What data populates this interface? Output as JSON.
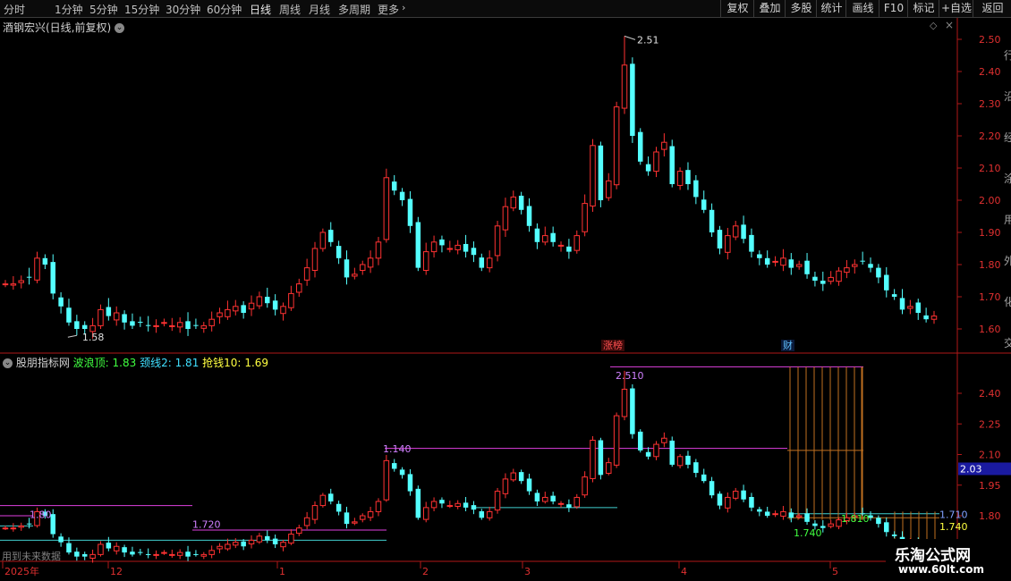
{
  "toolbar": {
    "periods": [
      "分时",
      "1分钟",
      "5分钟",
      "15分钟",
      "30分钟",
      "60分钟",
      "日线",
      "周线",
      "月线",
      "多周期",
      "更多"
    ],
    "active_period": "日线",
    "more_icon": "chevron-right-icon",
    "buttons": [
      "复权",
      "叠加",
      "多股",
      "统计",
      "画线",
      "F10",
      "标记",
      "+自选",
      "返回"
    ]
  },
  "main_panel": {
    "title": "酒钢宏兴(日线,前复权)",
    "title_icon": "chevron-down-icon",
    "diamond_icon": "diamond-icon",
    "close_icon": "close-icon",
    "y_ticks": [
      "2.50",
      "2.40",
      "2.30",
      "2.20",
      "2.10",
      "2.00",
      "1.90",
      "1.80",
      "1.70",
      "1.60"
    ],
    "high_label": "2.51",
    "low_label": "1.58",
    "badge_zhangbang": "涨榜",
    "badge_cai": "财",
    "right_edge_chars": [
      "行",
      "沿",
      "经",
      "涂",
      "用",
      "外",
      "化",
      "交"
    ]
  },
  "indicator_panel": {
    "title": "股朋指标网",
    "wave_label": "波浪顶:",
    "wave_value": "1.83",
    "neck_label": "颈线2:",
    "neck_value": "1.81",
    "grab_label": "抢钱10:",
    "grab_value": "1.69",
    "y_ticks": [
      "2.40",
      "2.25",
      "2.10",
      "1.95",
      "1.80"
    ],
    "current_price": "2.03",
    "annotations": [
      "2.510",
      "1.140",
      "1.720",
      "1.740",
      "1.80",
      "1.810",
      "1.710",
      "1.740"
    ],
    "future_data_note": "用到未来数据"
  },
  "x_axis": {
    "labels": [
      "2025年",
      "12",
      "1",
      "2",
      "3",
      "4",
      "5"
    ]
  },
  "watermark": {
    "name": "乐淘公式网",
    "url": "www.60lt.com"
  },
  "colors": {
    "up": "#ff3232",
    "down": "#54ffff",
    "axis": "#b01818",
    "grid_text": "#e03030",
    "magenta": "#e040e0",
    "orange": "#c07020",
    "cyan_line": "#40d0d0",
    "green_text": "#40ff40",
    "yellow_text": "#ffff40"
  }
}
